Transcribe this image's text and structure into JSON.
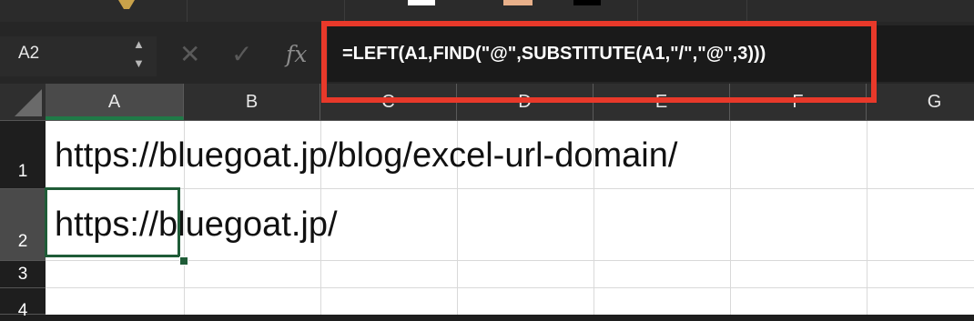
{
  "name_box": {
    "value": "A2"
  },
  "formula_bar": {
    "fx_label": "fx",
    "cancel_symbol": "✕",
    "enter_symbol": "✓",
    "formula": "=LEFT(A1,FIND(\"@\",SUBSTITUTE(A1,\"/\",\"@\",3)))"
  },
  "columns": [
    "A",
    "B",
    "C",
    "D",
    "E",
    "F",
    "G"
  ],
  "rows": [
    "1",
    "2",
    "3",
    "4"
  ],
  "cells": {
    "A1": "https://bluegoat.jp/blog/excel-url-domain/",
    "A2": "https://bluegoat.jp/"
  },
  "selection": {
    "active_cell": "A2",
    "column": "A",
    "row": "2"
  },
  "colors": {
    "highlight": "#e8392a",
    "selection": "#1f5c37",
    "header_bg": "#2f2f2f"
  },
  "icons": [
    "stepper-up-icon",
    "stepper-down-icon",
    "cancel-icon",
    "enter-icon",
    "fx-icon"
  ]
}
